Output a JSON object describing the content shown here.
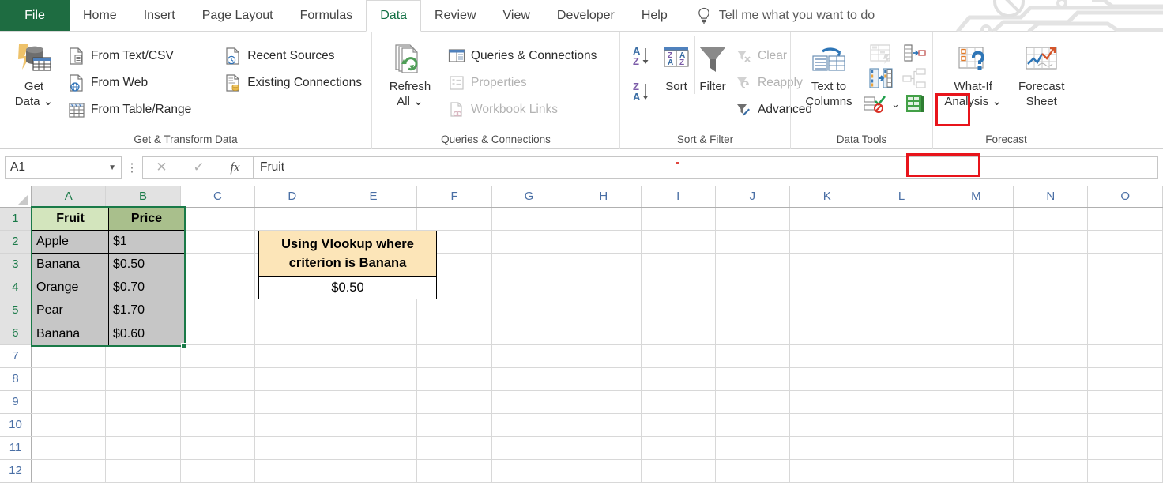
{
  "ribbon": {
    "tabs": [
      {
        "label": "File",
        "active": false,
        "file": true
      },
      {
        "label": "Home",
        "active": false
      },
      {
        "label": "Insert",
        "active": false
      },
      {
        "label": "Page Layout",
        "active": false
      },
      {
        "label": "Formulas",
        "active": false
      },
      {
        "label": "Data",
        "active": true
      },
      {
        "label": "Review",
        "active": false
      },
      {
        "label": "View",
        "active": false
      },
      {
        "label": "Developer",
        "active": false
      },
      {
        "label": "Help",
        "active": false
      }
    ],
    "tellme": {
      "icon": "lightbulb-icon",
      "placeholder": "Tell me what you want to do"
    },
    "groups": [
      {
        "title": "Get & Transform Data",
        "big": [
          {
            "label1": "Get",
            "label2": "Data",
            "icon": "get-data-icon",
            "dropdown": true
          }
        ],
        "small": [
          {
            "label": "From Text/CSV",
            "icon": "from-text-csv-icon",
            "disabled": false
          },
          {
            "label": "From Web",
            "icon": "from-web-icon",
            "disabled": false
          },
          {
            "label": "From Table/Range",
            "icon": "from-table-range-icon",
            "disabled": false
          }
        ],
        "small2": [
          {
            "label": "Recent Sources",
            "icon": "recent-sources-icon",
            "disabled": false
          },
          {
            "label": "Existing Connections",
            "icon": "existing-connections-icon",
            "disabled": false
          }
        ]
      },
      {
        "title": "Queries & Connections",
        "big": [
          {
            "label1": "Refresh",
            "label2": "All",
            "icon": "refresh-all-icon",
            "dropdown": true
          }
        ],
        "small": [
          {
            "label": "Queries & Connections",
            "icon": "queries-connections-icon",
            "disabled": false
          },
          {
            "label": "Properties",
            "icon": "properties-icon",
            "disabled": true
          },
          {
            "label": "Workbook Links",
            "icon": "workbook-links-icon",
            "disabled": true
          }
        ]
      },
      {
        "title": "Sort & Filter",
        "sortbuttons": [
          {
            "name": "sort-ascending-icon",
            "label": "AZ"
          },
          {
            "name": "sort-descending-icon",
            "label": "ZA"
          }
        ],
        "big": [
          {
            "label1": "Sort",
            "label2": "",
            "icon": "sort-icon"
          },
          {
            "label1": "Filter",
            "label2": "",
            "icon": "filter-icon"
          }
        ],
        "small": [
          {
            "label": "Clear",
            "icon": "clear-filter-icon",
            "disabled": true
          },
          {
            "label": "Reapply",
            "icon": "reapply-filter-icon",
            "disabled": true
          },
          {
            "label": "Advanced",
            "icon": "advanced-filter-icon",
            "disabled": false
          }
        ]
      },
      {
        "title": "Data Tools",
        "big": [
          {
            "label1": "Text to",
            "label2": "Columns",
            "icon": "text-to-columns-icon"
          }
        ],
        "icons": [
          {
            "name": "flash-fill-icon",
            "disabled": true
          },
          {
            "name": "remove-duplicates-icon",
            "disabled": false,
            "highlighted": true
          },
          {
            "name": "data-validation-icon",
            "disabled": false,
            "dropdown": true
          },
          {
            "name": "consolidate-icon",
            "disabled": false
          },
          {
            "name": "relationships-icon",
            "disabled": true
          },
          {
            "name": "manage-data-model-icon",
            "disabled": false
          }
        ],
        "highlighted": true
      },
      {
        "title": "Forecast",
        "big": [
          {
            "label1": "What-If",
            "label2": "Analysis",
            "icon": "what-if-analysis-icon",
            "dropdown": true
          },
          {
            "label1": "Forecast",
            "label2": "Sheet",
            "icon": "forecast-sheet-icon"
          }
        ]
      }
    ],
    "highlight_color": "#e8141b"
  },
  "formula_bar": {
    "name_box": "A1",
    "cancel_icon": "cancel-icon",
    "enter_icon": "confirm-icon",
    "function_icon": "insert-function-icon",
    "formula": "Fruit"
  },
  "grid": {
    "columns": [
      "A",
      "B",
      "C",
      "D",
      "E",
      "F",
      "G",
      "H",
      "I",
      "J",
      "K",
      "L",
      "M",
      "N",
      "O"
    ],
    "selected_columns": [
      "A",
      "B"
    ],
    "rows": [
      "1",
      "2",
      "3",
      "4",
      "5",
      "6",
      "7",
      "8",
      "9",
      "10",
      "11",
      "12"
    ],
    "selected_rows": [
      "1",
      "2",
      "3",
      "4",
      "5",
      "6"
    ],
    "selection_range": "A1:B6",
    "table": {
      "headers": [
        "Fruit",
        "Price"
      ],
      "header_colors": [
        "#d3e5bd",
        "#a9bf8c"
      ],
      "rows": [
        [
          "Apple",
          "$1"
        ],
        [
          "Banana",
          "$0.50"
        ],
        [
          "Orange",
          "$0.70"
        ],
        [
          "Pear",
          "$1.70"
        ],
        [
          "Banana",
          "$0.60"
        ]
      ],
      "body_fill": "#c6c6c6"
    },
    "callout": {
      "title": "Using Vlookup where criterion is Banana",
      "value": "$0.50",
      "title_fill": "#fce5b8",
      "value_fill": "#ffffff"
    }
  }
}
